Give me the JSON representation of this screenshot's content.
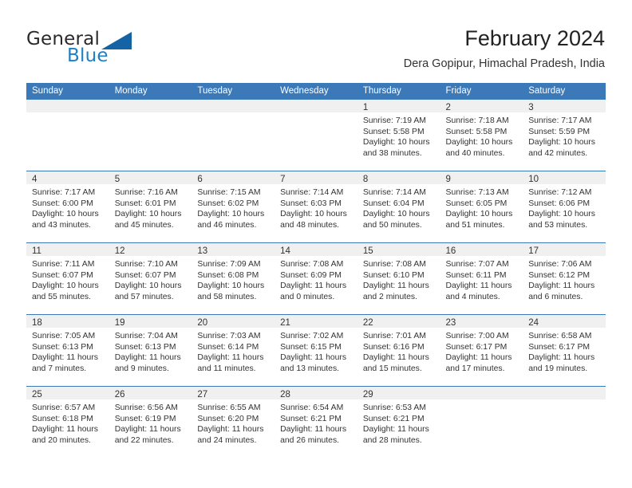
{
  "brand": {
    "name_part1": "General",
    "name_part2": "Blue",
    "accent_color": "#1f7fc4",
    "triangle_color": "#1464a5"
  },
  "header": {
    "month_title": "February 2024",
    "location": "Dera Gopipur, Himachal Pradesh, India"
  },
  "theme": {
    "header_row_bg": "#3b79b9",
    "day_band_bg": "#f0f0f0",
    "row_divider": "#3b79b9",
    "text": "#333333"
  },
  "weekdays": [
    "Sunday",
    "Monday",
    "Tuesday",
    "Wednesday",
    "Thursday",
    "Friday",
    "Saturday"
  ],
  "weeks": [
    [
      {
        "day": "",
        "sunrise": "",
        "sunset": "",
        "daylight_line1": "",
        "daylight_line2": ""
      },
      {
        "day": "",
        "sunrise": "",
        "sunset": "",
        "daylight_line1": "",
        "daylight_line2": ""
      },
      {
        "day": "",
        "sunrise": "",
        "sunset": "",
        "daylight_line1": "",
        "daylight_line2": ""
      },
      {
        "day": "",
        "sunrise": "",
        "sunset": "",
        "daylight_line1": "",
        "daylight_line2": ""
      },
      {
        "day": "1",
        "sunrise": "Sunrise: 7:19 AM",
        "sunset": "Sunset: 5:58 PM",
        "daylight_line1": "Daylight: 10 hours",
        "daylight_line2": "and 38 minutes."
      },
      {
        "day": "2",
        "sunrise": "Sunrise: 7:18 AM",
        "sunset": "Sunset: 5:58 PM",
        "daylight_line1": "Daylight: 10 hours",
        "daylight_line2": "and 40 minutes."
      },
      {
        "day": "3",
        "sunrise": "Sunrise: 7:17 AM",
        "sunset": "Sunset: 5:59 PM",
        "daylight_line1": "Daylight: 10 hours",
        "daylight_line2": "and 42 minutes."
      }
    ],
    [
      {
        "day": "4",
        "sunrise": "Sunrise: 7:17 AM",
        "sunset": "Sunset: 6:00 PM",
        "daylight_line1": "Daylight: 10 hours",
        "daylight_line2": "and 43 minutes."
      },
      {
        "day": "5",
        "sunrise": "Sunrise: 7:16 AM",
        "sunset": "Sunset: 6:01 PM",
        "daylight_line1": "Daylight: 10 hours",
        "daylight_line2": "and 45 minutes."
      },
      {
        "day": "6",
        "sunrise": "Sunrise: 7:15 AM",
        "sunset": "Sunset: 6:02 PM",
        "daylight_line1": "Daylight: 10 hours",
        "daylight_line2": "and 46 minutes."
      },
      {
        "day": "7",
        "sunrise": "Sunrise: 7:14 AM",
        "sunset": "Sunset: 6:03 PM",
        "daylight_line1": "Daylight: 10 hours",
        "daylight_line2": "and 48 minutes."
      },
      {
        "day": "8",
        "sunrise": "Sunrise: 7:14 AM",
        "sunset": "Sunset: 6:04 PM",
        "daylight_line1": "Daylight: 10 hours",
        "daylight_line2": "and 50 minutes."
      },
      {
        "day": "9",
        "sunrise": "Sunrise: 7:13 AM",
        "sunset": "Sunset: 6:05 PM",
        "daylight_line1": "Daylight: 10 hours",
        "daylight_line2": "and 51 minutes."
      },
      {
        "day": "10",
        "sunrise": "Sunrise: 7:12 AM",
        "sunset": "Sunset: 6:06 PM",
        "daylight_line1": "Daylight: 10 hours",
        "daylight_line2": "and 53 minutes."
      }
    ],
    [
      {
        "day": "11",
        "sunrise": "Sunrise: 7:11 AM",
        "sunset": "Sunset: 6:07 PM",
        "daylight_line1": "Daylight: 10 hours",
        "daylight_line2": "and 55 minutes."
      },
      {
        "day": "12",
        "sunrise": "Sunrise: 7:10 AM",
        "sunset": "Sunset: 6:07 PM",
        "daylight_line1": "Daylight: 10 hours",
        "daylight_line2": "and 57 minutes."
      },
      {
        "day": "13",
        "sunrise": "Sunrise: 7:09 AM",
        "sunset": "Sunset: 6:08 PM",
        "daylight_line1": "Daylight: 10 hours",
        "daylight_line2": "and 58 minutes."
      },
      {
        "day": "14",
        "sunrise": "Sunrise: 7:08 AM",
        "sunset": "Sunset: 6:09 PM",
        "daylight_line1": "Daylight: 11 hours",
        "daylight_line2": "and 0 minutes."
      },
      {
        "day": "15",
        "sunrise": "Sunrise: 7:08 AM",
        "sunset": "Sunset: 6:10 PM",
        "daylight_line1": "Daylight: 11 hours",
        "daylight_line2": "and 2 minutes."
      },
      {
        "day": "16",
        "sunrise": "Sunrise: 7:07 AM",
        "sunset": "Sunset: 6:11 PM",
        "daylight_line1": "Daylight: 11 hours",
        "daylight_line2": "and 4 minutes."
      },
      {
        "day": "17",
        "sunrise": "Sunrise: 7:06 AM",
        "sunset": "Sunset: 6:12 PM",
        "daylight_line1": "Daylight: 11 hours",
        "daylight_line2": "and 6 minutes."
      }
    ],
    [
      {
        "day": "18",
        "sunrise": "Sunrise: 7:05 AM",
        "sunset": "Sunset: 6:13 PM",
        "daylight_line1": "Daylight: 11 hours",
        "daylight_line2": "and 7 minutes."
      },
      {
        "day": "19",
        "sunrise": "Sunrise: 7:04 AM",
        "sunset": "Sunset: 6:13 PM",
        "daylight_line1": "Daylight: 11 hours",
        "daylight_line2": "and 9 minutes."
      },
      {
        "day": "20",
        "sunrise": "Sunrise: 7:03 AM",
        "sunset": "Sunset: 6:14 PM",
        "daylight_line1": "Daylight: 11 hours",
        "daylight_line2": "and 11 minutes."
      },
      {
        "day": "21",
        "sunrise": "Sunrise: 7:02 AM",
        "sunset": "Sunset: 6:15 PM",
        "daylight_line1": "Daylight: 11 hours",
        "daylight_line2": "and 13 minutes."
      },
      {
        "day": "22",
        "sunrise": "Sunrise: 7:01 AM",
        "sunset": "Sunset: 6:16 PM",
        "daylight_line1": "Daylight: 11 hours",
        "daylight_line2": "and 15 minutes."
      },
      {
        "day": "23",
        "sunrise": "Sunrise: 7:00 AM",
        "sunset": "Sunset: 6:17 PM",
        "daylight_line1": "Daylight: 11 hours",
        "daylight_line2": "and 17 minutes."
      },
      {
        "day": "24",
        "sunrise": "Sunrise: 6:58 AM",
        "sunset": "Sunset: 6:17 PM",
        "daylight_line1": "Daylight: 11 hours",
        "daylight_line2": "and 19 minutes."
      }
    ],
    [
      {
        "day": "25",
        "sunrise": "Sunrise: 6:57 AM",
        "sunset": "Sunset: 6:18 PM",
        "daylight_line1": "Daylight: 11 hours",
        "daylight_line2": "and 20 minutes."
      },
      {
        "day": "26",
        "sunrise": "Sunrise: 6:56 AM",
        "sunset": "Sunset: 6:19 PM",
        "daylight_line1": "Daylight: 11 hours",
        "daylight_line2": "and 22 minutes."
      },
      {
        "day": "27",
        "sunrise": "Sunrise: 6:55 AM",
        "sunset": "Sunset: 6:20 PM",
        "daylight_line1": "Daylight: 11 hours",
        "daylight_line2": "and 24 minutes."
      },
      {
        "day": "28",
        "sunrise": "Sunrise: 6:54 AM",
        "sunset": "Sunset: 6:21 PM",
        "daylight_line1": "Daylight: 11 hours",
        "daylight_line2": "and 26 minutes."
      },
      {
        "day": "29",
        "sunrise": "Sunrise: 6:53 AM",
        "sunset": "Sunset: 6:21 PM",
        "daylight_line1": "Daylight: 11 hours",
        "daylight_line2": "and 28 minutes."
      },
      {
        "day": "",
        "sunrise": "",
        "sunset": "",
        "daylight_line1": "",
        "daylight_line2": ""
      },
      {
        "day": "",
        "sunrise": "",
        "sunset": "",
        "daylight_line1": "",
        "daylight_line2": ""
      }
    ]
  ]
}
